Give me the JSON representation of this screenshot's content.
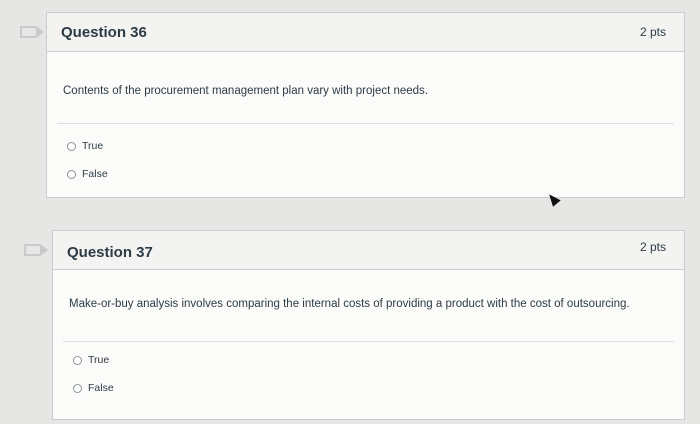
{
  "questions": [
    {
      "title": "Question 36",
      "points": "2 pts",
      "text": "Contents of the procurement management plan vary with project needs.",
      "options": [
        "True",
        "False"
      ]
    },
    {
      "title": "Question 37",
      "points": "2 pts",
      "text": "Make-or-buy analysis involves comparing the internal costs of providing a product with the cost of outsourcing.",
      "options": [
        "True",
        "False"
      ]
    }
  ],
  "colors": {
    "background": "#e6e6e4",
    "card": "#fbfbfa",
    "header": "#f3f3f2",
    "text": "#2d3b45",
    "flag": "#c9c9c9"
  },
  "icons": {
    "flag": "flag-icon",
    "cursor": "mouse-pointer-icon"
  }
}
